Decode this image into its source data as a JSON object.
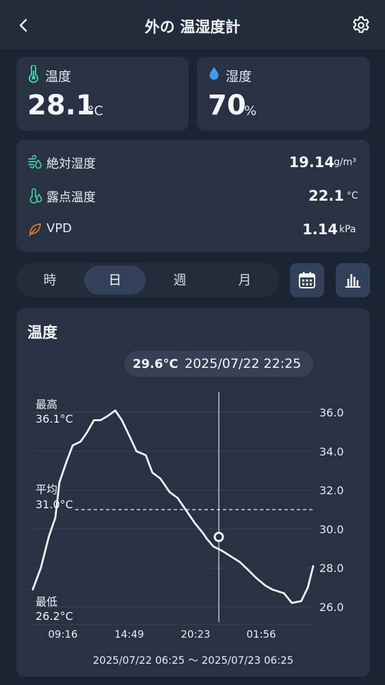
{
  "header": {
    "title": "外の 温湿度計",
    "back_icon": "chevron-left-icon",
    "settings_icon": "gear-icon"
  },
  "temperature_card": {
    "label": "温度",
    "value": "28.1",
    "unit": "°C",
    "icon": "thermometer-icon",
    "icon_color": "#3fcfa8"
  },
  "humidity_card": {
    "label": "湿度",
    "value": "70",
    "unit": "%",
    "icon": "water-drop-icon",
    "icon_color": "#3d9bf0"
  },
  "metrics": [
    {
      "label": "絶対湿度",
      "value": "19.14",
      "unit": "g/m³",
      "icon": "wind-drop-icon",
      "icon_color": "#3fcfa8"
    },
    {
      "label": "露点温度",
      "value": "22.1",
      "unit": "°C",
      "icon": "dew-point-icon",
      "icon_color": "#3fcfa8"
    },
    {
      "label": "VPD",
      "value": "1.14",
      "unit": "kPa",
      "icon": "leaf-icon",
      "icon_color": "#e07a2f"
    }
  ],
  "period_tabs": [
    {
      "label": "時",
      "active": false
    },
    {
      "label": "日",
      "active": true
    },
    {
      "label": "週",
      "active": false
    },
    {
      "label": "月",
      "active": false
    }
  ],
  "action_buttons": {
    "calendar_icon": "calendar-icon",
    "bar_chart_icon": "bar-chart-icon"
  },
  "chart_card": {
    "title": "温度",
    "tooltip_value": "29.6°C",
    "tooltip_time": "2025/07/22 22:25",
    "range_label": "2025/07/22 06:25 〜 2025/07/23 06:25"
  },
  "chart_data": {
    "type": "line",
    "title": "温度",
    "y_ticks": [
      "36.0",
      "34.0",
      "32.0",
      "30.0",
      "28.0",
      "26.0"
    ],
    "y_tick_values": [
      36,
      34,
      32,
      30,
      28,
      26
    ],
    "x_ticks": [
      "09:16",
      "14:49",
      "20:23",
      "01:56"
    ],
    "ylim": [
      25.5,
      37
    ],
    "grid": true,
    "annotations": {
      "max_label": "最高",
      "max_value": "36.1°C",
      "avg_label": "平均",
      "avg_value": "31.0°C",
      "min_label": "最低",
      "min_value": "26.2°C"
    },
    "average": 31.0,
    "cursor": {
      "time": "2025/07/22 22:25",
      "value": 29.6
    },
    "series": [
      {
        "values": [
          [
            0.0,
            26.9
          ],
          [
            0.6,
            28.0
          ],
          [
            1.2,
            29.6
          ],
          [
            1.7,
            30.6
          ],
          [
            2.0,
            32.4
          ],
          [
            2.5,
            33.4
          ],
          [
            3.0,
            34.3
          ],
          [
            3.6,
            34.5
          ],
          [
            4.1,
            35.0
          ],
          [
            4.6,
            35.6
          ],
          [
            5.1,
            35.6
          ],
          [
            5.6,
            35.8
          ],
          [
            6.2,
            36.1
          ],
          [
            6.7,
            35.6
          ],
          [
            7.4,
            34.6
          ],
          [
            7.8,
            34.0
          ],
          [
            8.5,
            33.8
          ],
          [
            9.0,
            32.9
          ],
          [
            9.6,
            32.6
          ],
          [
            10.3,
            31.9
          ],
          [
            10.9,
            31.6
          ],
          [
            11.6,
            30.9
          ],
          [
            12.2,
            30.3
          ],
          [
            12.8,
            29.8
          ],
          [
            13.1,
            29.5
          ],
          [
            13.6,
            29.1
          ],
          [
            14.2,
            28.9
          ],
          [
            14.9,
            28.6
          ],
          [
            15.6,
            28.3
          ],
          [
            16.2,
            27.9
          ],
          [
            16.8,
            27.5
          ],
          [
            17.5,
            27.1
          ],
          [
            18.0,
            26.9
          ],
          [
            18.9,
            26.7
          ],
          [
            19.5,
            26.2
          ],
          [
            20.2,
            26.3
          ],
          [
            20.7,
            27.0
          ],
          [
            21.1,
            28.1
          ]
        ]
      }
    ]
  }
}
